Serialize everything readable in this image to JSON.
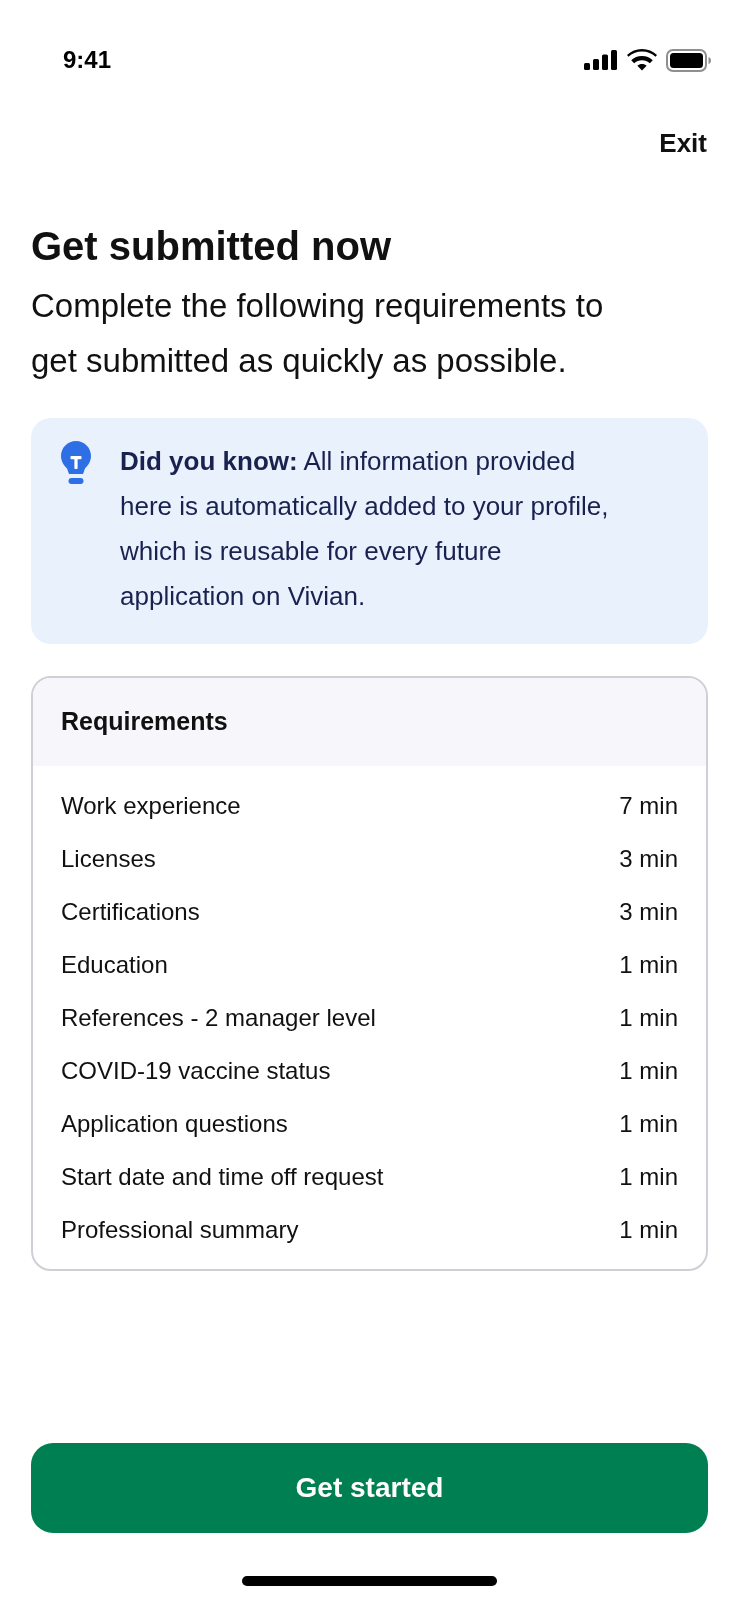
{
  "status_bar": {
    "time": "9:41"
  },
  "header": {
    "exit": "Exit"
  },
  "title": "Get submitted now",
  "subtitle": "Complete the following requirements to get submitted as quickly as possible.",
  "tip": {
    "text": "**Did you know:** All information provided here is automatically added to your profile, which is reusable for every future application on Vivian."
  },
  "requirements": {
    "title": "Requirements",
    "items": [
      {
        "name": "Work experience",
        "duration": "7 min"
      },
      {
        "name": "Licenses",
        "duration": "3 min"
      },
      {
        "name": "Certifications",
        "duration": "3 min"
      },
      {
        "name": "Education",
        "duration": "1 min"
      },
      {
        "name": "References - 2 manager level",
        "duration": "1 min"
      },
      {
        "name": "COVID-19 vaccine status",
        "duration": "1 min"
      },
      {
        "name": "Application questions",
        "duration": "1 min"
      },
      {
        "name": "Start date and time off request",
        "duration": "1 min"
      },
      {
        "name": "Professional summary",
        "duration": "1 min"
      }
    ]
  },
  "primary_button": {
    "label": "Get started"
  }
}
